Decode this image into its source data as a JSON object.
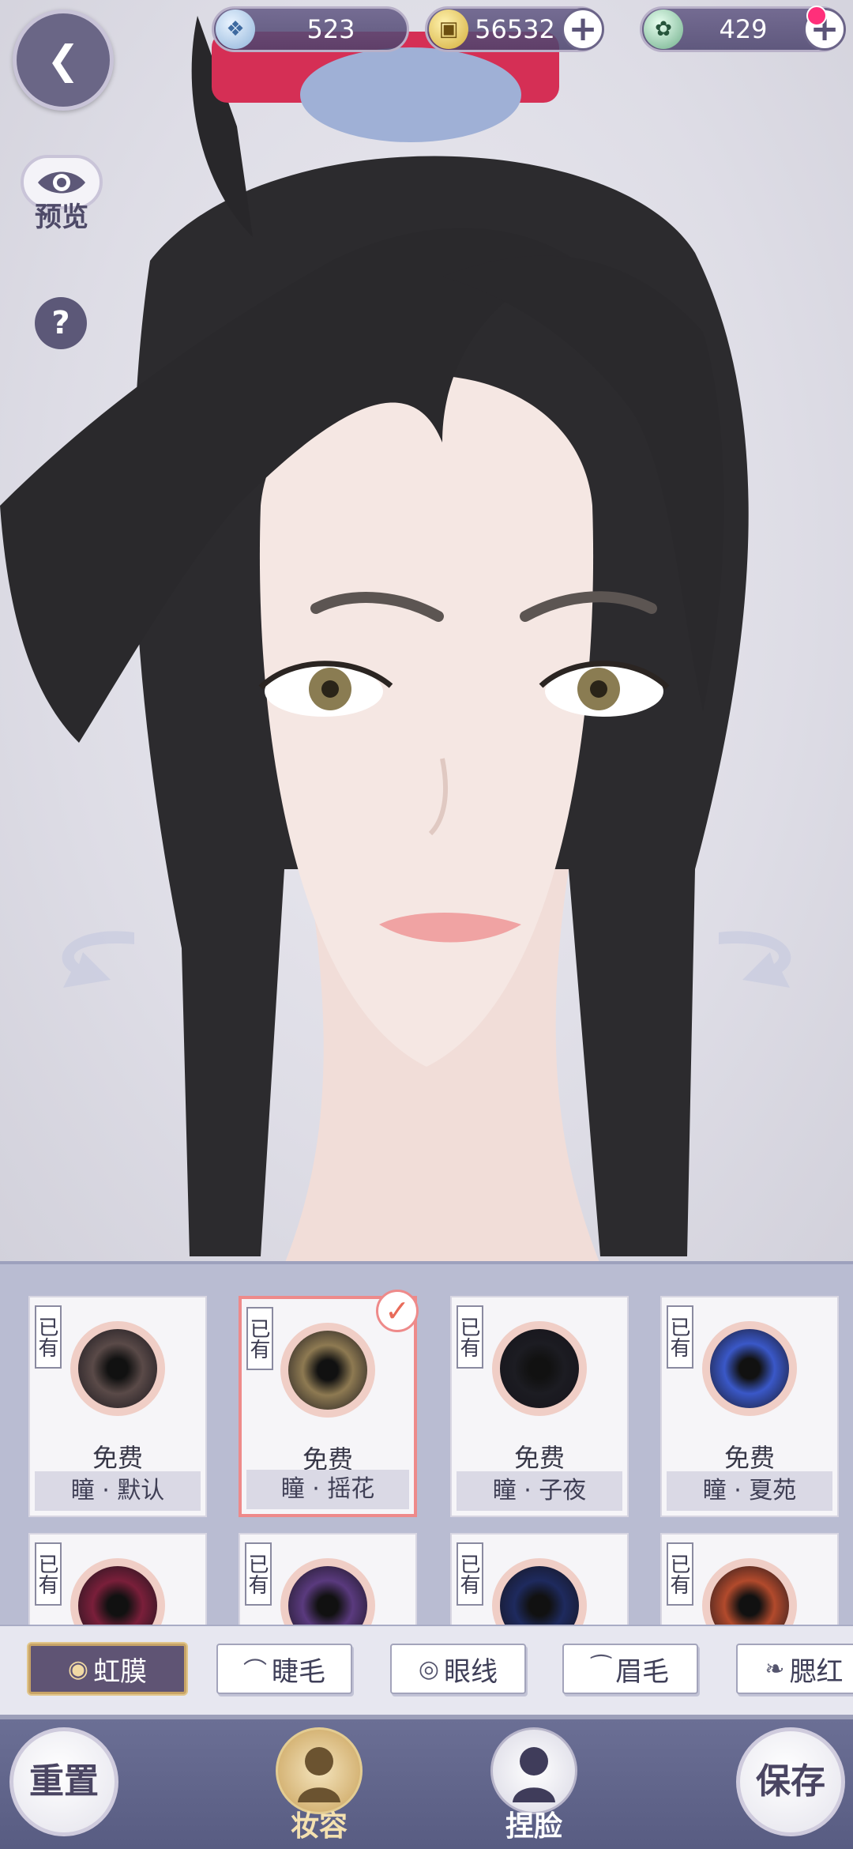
{
  "currency": {
    "jade": {
      "icon": "jade-icon",
      "value": "523"
    },
    "coin": {
      "icon": "copper-coin-icon",
      "value": "56532"
    },
    "token": {
      "icon": "token-icon",
      "value": "429",
      "has_notification": true
    }
  },
  "sidebar": {
    "preview_label": "预览",
    "help_glyph": "?"
  },
  "items": [
    {
      "owned": "已有",
      "price": "免费",
      "name": "瞳 · 默认",
      "color": "#5a4a48",
      "selected": false
    },
    {
      "owned": "已有",
      "price": "免费",
      "name": "瞳 · 摇花",
      "color": "#8e7a52",
      "selected": true
    },
    {
      "owned": "已有",
      "price": "免费",
      "name": "瞳 · 子夜",
      "color": "#1c1c22",
      "selected": false
    },
    {
      "owned": "已有",
      "price": "免费",
      "name": "瞳 · 夏苑",
      "color": "#3a58c8",
      "selected": false
    },
    {
      "owned": "已有",
      "color": "#7a1f3a"
    },
    {
      "owned": "已有",
      "color": "#5a3a7e"
    },
    {
      "owned": "已有",
      "color": "#1e2a5e"
    },
    {
      "owned": "已有",
      "color": "#b24a2c"
    }
  ],
  "tabs": [
    {
      "label": "虹膜",
      "icon": "iris-icon",
      "active": true
    },
    {
      "label": "睫毛",
      "icon": "eyelash-icon",
      "active": false
    },
    {
      "label": "眼线",
      "icon": "eyeliner-icon",
      "active": false
    },
    {
      "label": "眉毛",
      "icon": "eyebrow-icon",
      "active": false
    },
    {
      "label": "腮红",
      "icon": "blush-icon",
      "active": false
    }
  ],
  "bottom": {
    "reset_label": "重置",
    "makeup_label": "妆容",
    "face_label": "捏脸",
    "save_label": "保存"
  },
  "colors": {
    "panel": "#b9bcd2",
    "selected_border": "#ee8a8a",
    "bottom_bar": "#62668c"
  }
}
